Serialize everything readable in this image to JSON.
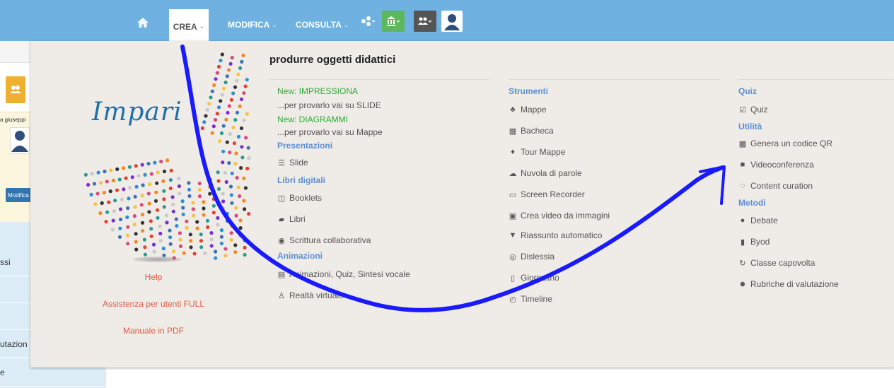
{
  "nav": {
    "crea": "CREA",
    "modifica": "MODIFICA",
    "consulta": "CONSULTA",
    "caret": "⌄",
    "icons": [
      "home-icon",
      "share-icon",
      "institution-icon",
      "group-icon",
      "profile-avatar"
    ],
    "colors": {
      "bar": "#6fb1e1",
      "share_btn": "#6fb1e1",
      "institution_btn": "#5cb85c",
      "group_btn": "#555555"
    }
  },
  "background_page": {
    "card_name": "a giuseppi",
    "modifica_button": "Modifica",
    "sidebar_items": [
      "ssi",
      "utazion",
      "e"
    ]
  },
  "dropdown": {
    "title": "produrre oggetti didattici",
    "logo_text": "Impari",
    "left_links": [
      "Help",
      "Assistenza per utenti FULL",
      "Manuale in PDF"
    ],
    "col1": {
      "new1": "New: IMPRESSIONA",
      "new1_sub": "...per provarlo vai su SLIDE",
      "new2": "New: DIAGRAMMI",
      "new2_sub": "...per provarlo vai su Mappe",
      "presentazioni_head": "Presentazioni",
      "slide": "Slide",
      "libri_head": "Libri digitali",
      "booklets": "Booklets",
      "libri": "Libri",
      "scrittura": "Scrittura collaborativa",
      "animazioni_head": "Animazioni",
      "animazioni": "Animazioni, Quiz, Sintesi vocale",
      "realta": "Realtà virtuale"
    },
    "col2": {
      "strumenti_head": "Strumenti",
      "items": [
        "Mappe",
        "Bacheca",
        "Tour Mappe",
        "Nuvola di parole",
        "Screen Recorder",
        "Crea video da immagini",
        "Riassunto automatico",
        "Dislessia",
        "Giornalino",
        "Timeline"
      ]
    },
    "col3": {
      "quiz_head": "Quiz",
      "quiz": "Quiz",
      "utilita_head": "Utilità",
      "qr": "Genera un codice QR",
      "video": "Videoconferenza",
      "curation": "Content curation",
      "metodi_head": "Metodi",
      "debate": "Debate",
      "byod": "Byod",
      "classe": "Classe capovolta",
      "rubriche": "Rubriche di valutazione"
    }
  }
}
